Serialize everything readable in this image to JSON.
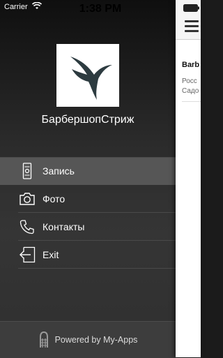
{
  "status_bar": {
    "carrier": "Carrier",
    "time": "1:38 PM"
  },
  "drawer": {
    "app_title": "БарбершопСтриж",
    "menu": [
      {
        "label": "Запись",
        "icon": "ticket-icon",
        "active": true
      },
      {
        "label": "Фото",
        "icon": "camera-icon",
        "active": false
      },
      {
        "label": "Контакты",
        "icon": "phone-icon",
        "active": false
      },
      {
        "label": "Exit",
        "icon": "exit-icon",
        "active": false
      }
    ],
    "footer_text": "Powered by My-Apps"
  },
  "content": {
    "heading": "Barb",
    "line1": "Росс",
    "line2": "Садо"
  },
  "colors": {
    "active_item_bg": "#565656",
    "footer_bg": "#3d3d3d",
    "panel_bg": "#ffffff"
  }
}
